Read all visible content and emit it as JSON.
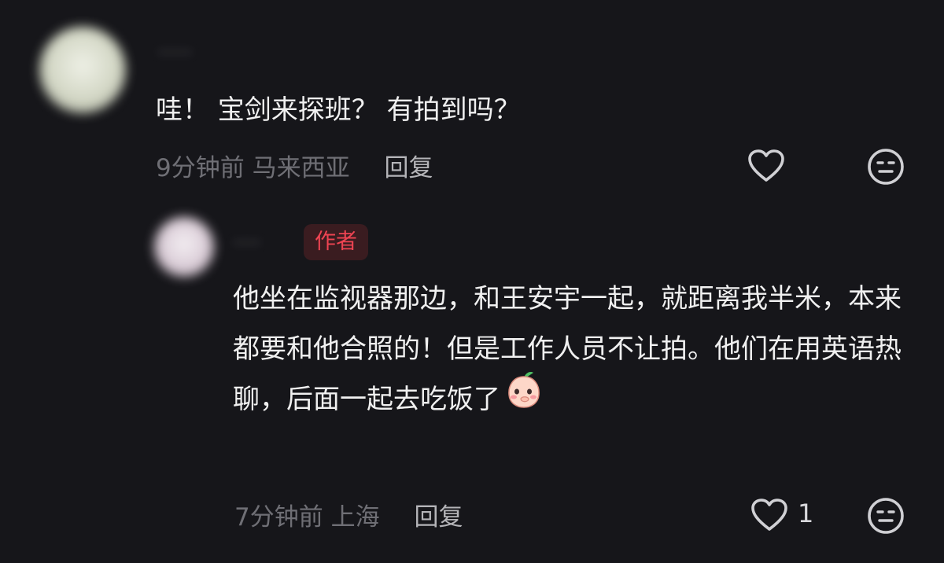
{
  "comment": {
    "author_name": "·····",
    "text": "哇！ 宝剑来探班？ 有拍到吗？",
    "time": "9分钟前",
    "location": "马来西亚",
    "reply_label": "回复",
    "like_icon": "heart-outline-icon",
    "dislike_icon": "neutral-face-icon"
  },
  "reply": {
    "author_name": "····",
    "badge": "作者",
    "text": "他坐在监视器那边，和王安宇一起，就距离我半米，本来都要和他合照的！但是工作人员不让拍。他们在用英语热聊，后面一起去吃饭了",
    "emoji": "peach-cover-mouth-emoji",
    "time": "7分钟前",
    "location": "上海",
    "reply_label": "回复",
    "like_count": "1",
    "like_icon": "heart-outline-icon",
    "dislike_icon": "neutral-face-icon"
  },
  "colors": {
    "background": "#16161a",
    "text": "#f0f0f0",
    "meta": "#6f6f75",
    "badge_text": "#ee4452",
    "badge_bg": "#3a1c20"
  }
}
